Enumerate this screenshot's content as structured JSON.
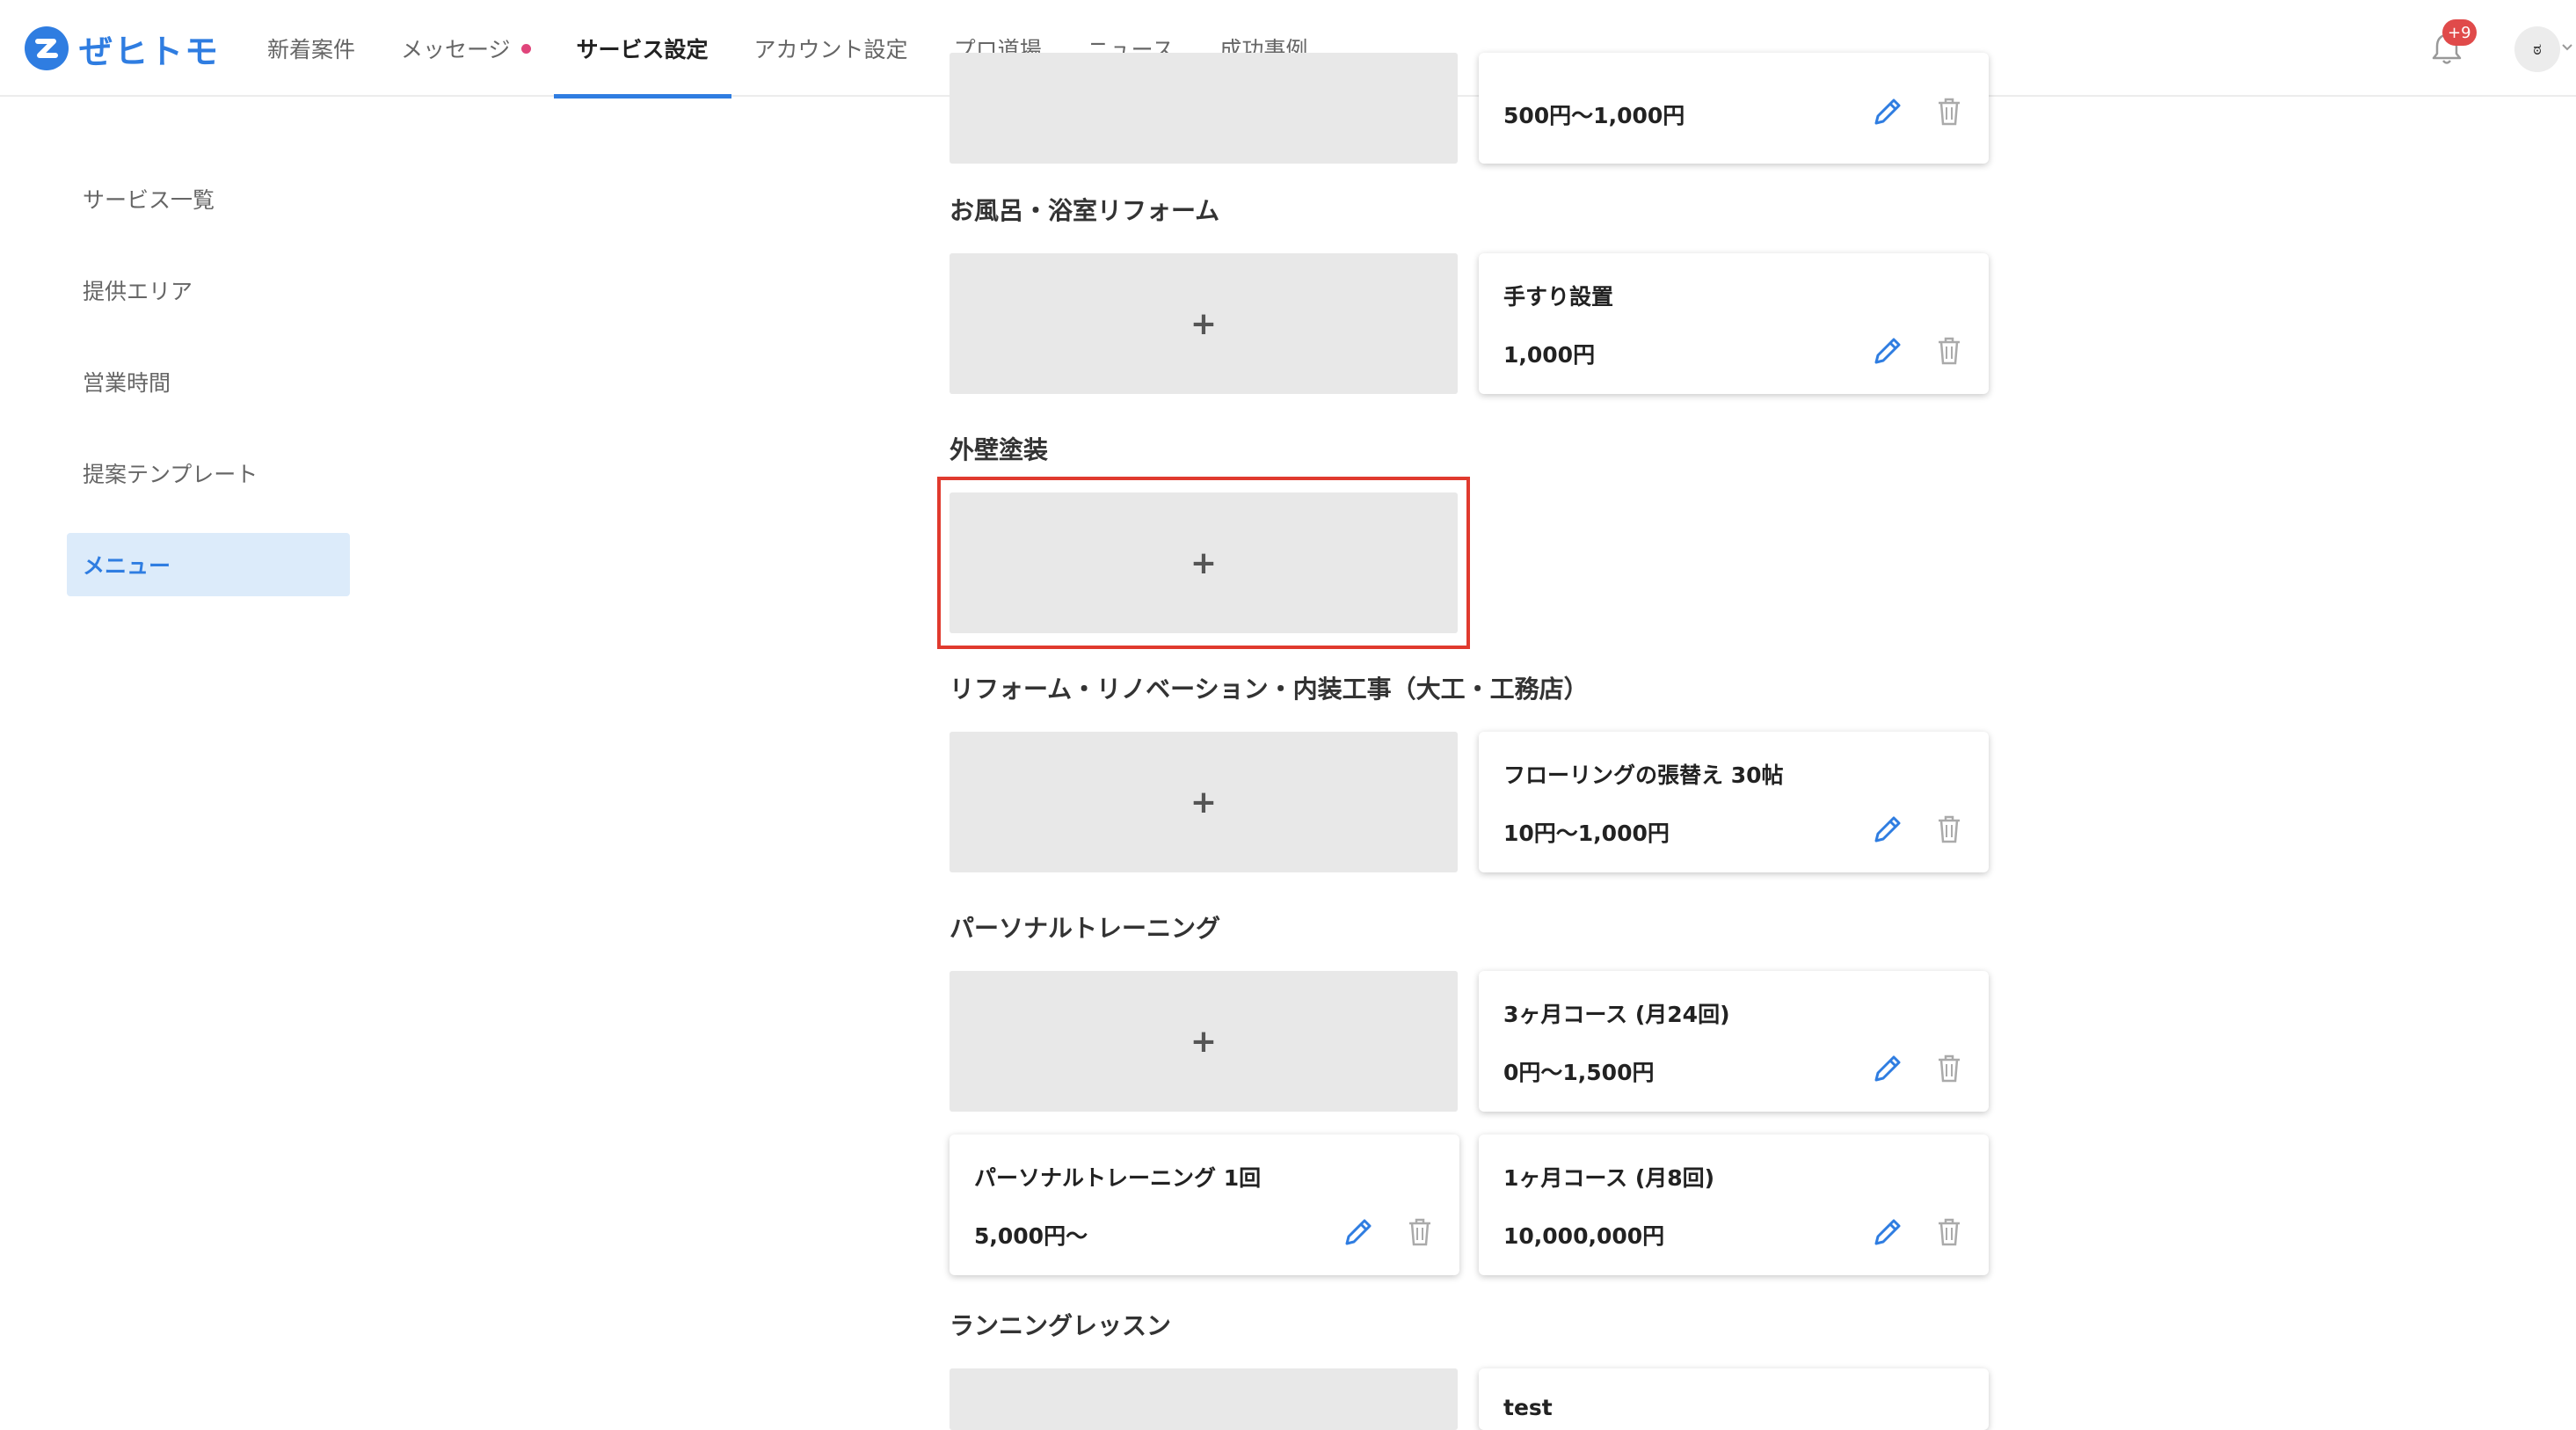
{
  "header": {
    "logo_text": "ぜヒトモ",
    "nav": [
      {
        "label": "新着案件",
        "active": false
      },
      {
        "label": "メッセージ",
        "active": false,
        "has_dot": true
      },
      {
        "label": "サービス設定",
        "active": true
      },
      {
        "label": "アカウント設定",
        "active": false
      },
      {
        "label": "プロ道場",
        "active": false
      },
      {
        "label": "ニュース",
        "active": false
      },
      {
        "label": "成功事例",
        "active": false
      }
    ],
    "notification_badge": "+9",
    "avatar_label": "ಠ"
  },
  "sidebar": {
    "items": [
      {
        "label": "サービス一覧",
        "active": false
      },
      {
        "label": "提供エリア",
        "active": false
      },
      {
        "label": "営業時間",
        "active": false
      },
      {
        "label": "提案テンプレート",
        "active": false
      },
      {
        "label": "メニュー",
        "active": true
      }
    ]
  },
  "main": {
    "add_symbol": "+",
    "sections": [
      {
        "title": "",
        "cards": [
          {
            "title": "",
            "price": "500円〜1,000円"
          }
        ]
      },
      {
        "title": "お風呂・浴室リフォーム",
        "cards": [
          {
            "title": "手すり設置",
            "price": "1,000円"
          }
        ]
      },
      {
        "title": "外壁塗装",
        "cards": [],
        "highlighted": true
      },
      {
        "title": "リフォーム・リノベーション・内装工事（大工・工務店）",
        "cards": [
          {
            "title": "フローリングの張替え 30帖",
            "price": "10円〜1,000円"
          }
        ]
      },
      {
        "title": "パーソナルトレーニング",
        "cards": [
          {
            "title": "3ヶ月コース (月24回)",
            "price": "0円〜1,500円"
          },
          {
            "title": "パーソナルトレーニング 1回",
            "price": "5,000円〜"
          },
          {
            "title": "1ヶ月コース (月8回)",
            "price": "10,000,000円"
          }
        ]
      },
      {
        "title": "ランニングレッスン",
        "cards": [
          {
            "title": "test",
            "price": ""
          }
        ]
      }
    ]
  },
  "colors": {
    "brand": "#2f7de1",
    "highlight": "#e03a2e",
    "badge": "#e04a4a",
    "sidebar_active_bg": "#dcebfa"
  }
}
